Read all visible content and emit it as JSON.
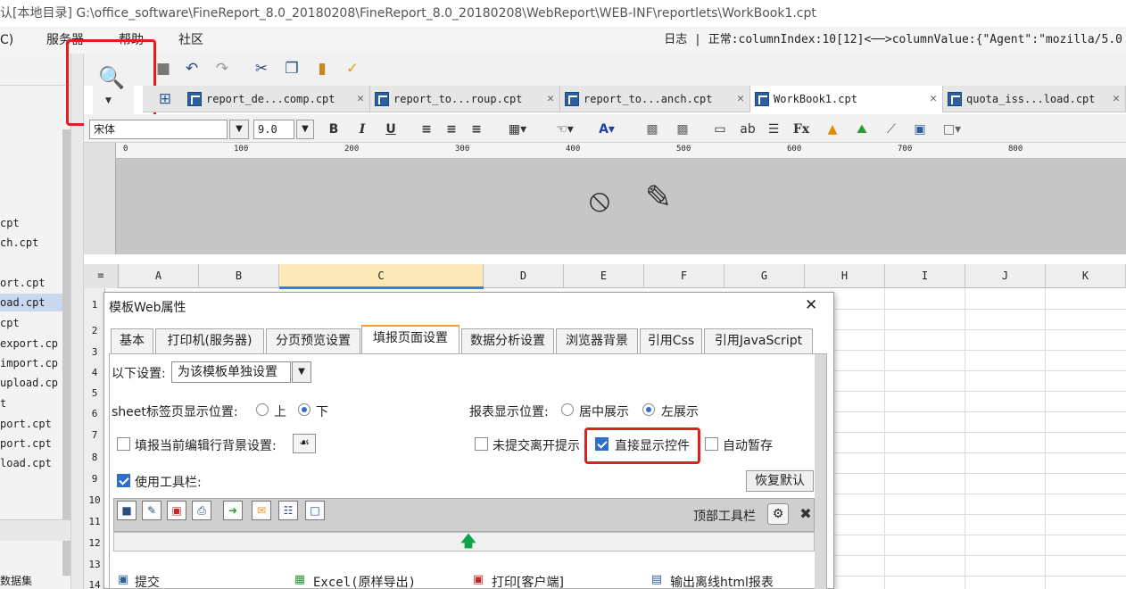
{
  "titlebar": {
    "text": "认[本地目录]    G:\\office_software\\FineReport_8.0_20180208\\FineReport_8.0_20180208\\WebReport\\WEB-INF\\reportlets\\WorkBook1.cpt"
  },
  "menubar": {
    "items": [
      "C)",
      "服务器",
      "帮助",
      "社区"
    ],
    "status": "日志  |  正常:columnIndex:10[12]<──>columnValue:{\"Agent\":\"mozilla/5.0"
  },
  "sidebar": {
    "files": [
      "cpt",
      "ch.cpt",
      "ort.cpt",
      "oad.cpt",
      "cpt",
      "export.cp",
      "import.cp",
      "upload.cp",
      "t",
      "port.cpt",
      "port.cpt",
      "load.cpt"
    ],
    "dataset_label": "数据集"
  },
  "tabs": [
    {
      "label": "report_de...comp.cpt",
      "close": "✕"
    },
    {
      "label": "report_to...roup.cpt",
      "close": "✕"
    },
    {
      "label": "report_to...anch.cpt",
      "close": "✕"
    },
    {
      "label": "WorkBook1.cpt",
      "close": "✕"
    },
    {
      "label": "quota_iss...load.cpt",
      "close": "✕"
    }
  ],
  "format": {
    "font": "宋体",
    "size": "9.0"
  },
  "ruler": {
    "ticks": [
      "0",
      "100",
      "200",
      "300",
      "400",
      "500",
      "600",
      "700",
      "800"
    ]
  },
  "grid": {
    "columns": [
      "A",
      "B",
      "C",
      "D",
      "E",
      "F",
      "G",
      "H",
      "I",
      "J",
      "K"
    ],
    "rows": [
      "1",
      "2",
      "3",
      "4",
      "5",
      "6",
      "7",
      "8",
      "9",
      "10",
      "11",
      "12",
      "13",
      "14"
    ]
  },
  "dialog": {
    "title": "模板Web属性",
    "close": "✕",
    "tabs": [
      "基本",
      "打印机(服务器)",
      "分页预览设置",
      "填报页面设置",
      "数据分析设置",
      "浏览器背景",
      "引用Css",
      "引用JavaScript"
    ],
    "settings_label": "以下设置:",
    "settings_value": "为该模板单独设置",
    "sheet_pos_label": "sheet标签页显示位置:",
    "sheet_pos_top": "上",
    "sheet_pos_bottom": "下",
    "report_pos_label": "报表显示位置:",
    "report_pos_center": "居中展示",
    "report_pos_left": "左展示",
    "fill_bg_label": "填报当前编辑行背景设置:",
    "unsubmitted_label": "未提交离开提示",
    "direct_show_label": "直接显示控件",
    "auto_save_label": "自动暂存",
    "use_toolbar_label": "使用工具栏:",
    "restore_default": "恢复默认",
    "top_toolbar_label": "顶部工具栏",
    "items": [
      "提交",
      "Excel(原样导出)",
      "打印[客户端]",
      "输出离线html报表"
    ]
  }
}
